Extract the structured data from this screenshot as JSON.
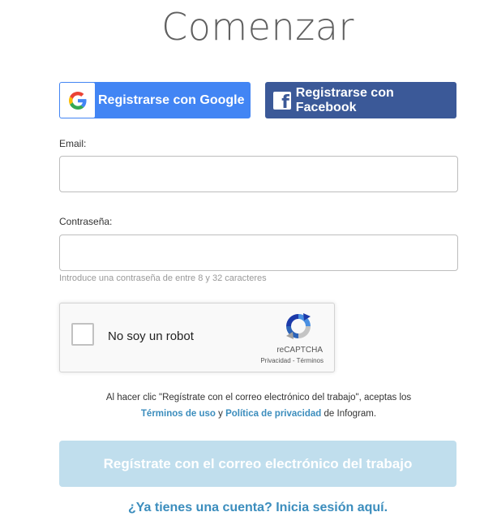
{
  "page": {
    "title": "Comenzar"
  },
  "social": {
    "google_label": "Registrarse con Google",
    "facebook_label": "Registrarse con Facebook",
    "facebook_icon_glyph": "f",
    "google_color": "#4285f4",
    "facebook_color": "#3b5998"
  },
  "form": {
    "email_label": "Email:",
    "email_value": "",
    "password_label": "Contraseña:",
    "password_value": "",
    "password_hint": "Introduce una contraseña de entre 8 y 32 caracteres"
  },
  "recaptcha": {
    "checkbox_label": "No soy un robot",
    "brand": "reCAPTCHA",
    "privacy": "Privacidad",
    "separator": " - ",
    "terms": "Términos"
  },
  "terms": {
    "line1": "Al hacer clic \"Regístrate con el correo electrónico del trabajo\", aceptas los",
    "terms_link": "Términos de uso",
    "and": " y ",
    "privacy_link": "Política de privacidad",
    "suffix": " de Infogram."
  },
  "actions": {
    "submit_label": "Regístrate con el correo electrónico del trabajo",
    "login_link": "¿Ya tienes una cuenta? Inicia sesión aquí.",
    "submit_color": "#c0deed",
    "link_color": "#3b8dbd"
  }
}
